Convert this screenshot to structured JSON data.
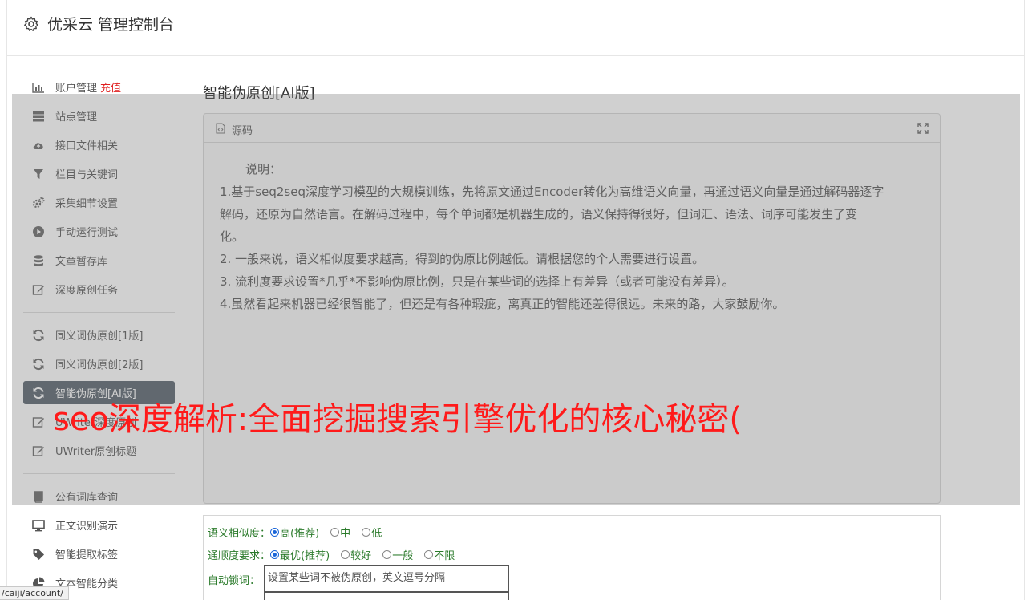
{
  "header": {
    "title": "优采云 管理控制台"
  },
  "sidebar": {
    "items": [
      {
        "label": "账户管理",
        "extra": "充值",
        "icon": "bar-chart-icon"
      },
      {
        "label": "站点管理",
        "icon": "server-icon"
      },
      {
        "label": "接口文件相关",
        "icon": "cloud-upload-icon"
      },
      {
        "label": "栏目与关键词",
        "icon": "filter-icon"
      },
      {
        "label": "采集细节设置",
        "icon": "gears-icon"
      },
      {
        "label": "手动运行测试",
        "icon": "play-circle-icon"
      },
      {
        "label": "文章暂存库",
        "icon": "database-icon"
      },
      {
        "label": "深度原创任务",
        "icon": "edit-icon"
      },
      {
        "label": "同义词伪原创[1版]",
        "icon": "refresh-icon"
      },
      {
        "label": "同义词伪原创[2版]",
        "icon": "refresh-icon"
      },
      {
        "label": "智能伪原创[AI版]",
        "icon": "refresh-icon",
        "active": true
      },
      {
        "label": "UWriter深度原创",
        "icon": "edit-icon"
      },
      {
        "label": "UWriter原创标题",
        "icon": "edit-icon"
      },
      {
        "label": "公有词库查询",
        "icon": "book-icon"
      },
      {
        "label": "正文识别演示",
        "icon": "monitor-icon"
      },
      {
        "label": "智能提取标签",
        "icon": "tag-icon"
      },
      {
        "label": "文本智能分类",
        "icon": "pie-chart-icon"
      }
    ]
  },
  "main": {
    "heading": "智能伪原创[AI版]",
    "source_panel": {
      "label": "源码",
      "lines": [
        "说明：",
        "1.基于seq2seq深度学习模型的大规模训练，先将原文通过Encoder转化为高维语义向量，再通过语义向量是通过解码器逐字",
        "解码，还原为自然语言。在解码过程中，每个单词都是机器生成的，语义保持得很好，但词汇、语法、词序可能发生了变",
        "化。",
        "2. 一般来说，语义相似度要求越高，得到的伪原比例越低。请根据您的个人需要进行设置。",
        "3. 流利度要求设置*几乎*不影响伪原比例，只是在某些词的选择上有差异（或者可能没有差异）。",
        "4.虽然看起来机器已经很智能了，但还是有各种瑕疵，离真正的智能还差得很远。未来的路，大家鼓励你。"
      ]
    },
    "watermark": "seo深度解析:全面挖掘搜索引擎优化的核心秘密(",
    "options": {
      "similarity": {
        "label": "语义相似度：",
        "choices": [
          "高(推荐)",
          "中",
          "低"
        ],
        "selected": 0
      },
      "fluency": {
        "label": "通顺度要求：",
        "choices": [
          "最优(推荐)",
          "较好",
          "一般",
          "不限"
        ],
        "selected": 0
      },
      "lock": {
        "label": "自动锁词：",
        "placeholder": "设置某些词不被伪原创，英文逗号分隔"
      }
    }
  },
  "status_bar": {
    "url": "/caiji/account/"
  },
  "colors": {
    "active_bg": "#55606a",
    "recharge": "#e02020",
    "watermark": "#ff1a1a",
    "option_text": "#2a7a2a"
  }
}
